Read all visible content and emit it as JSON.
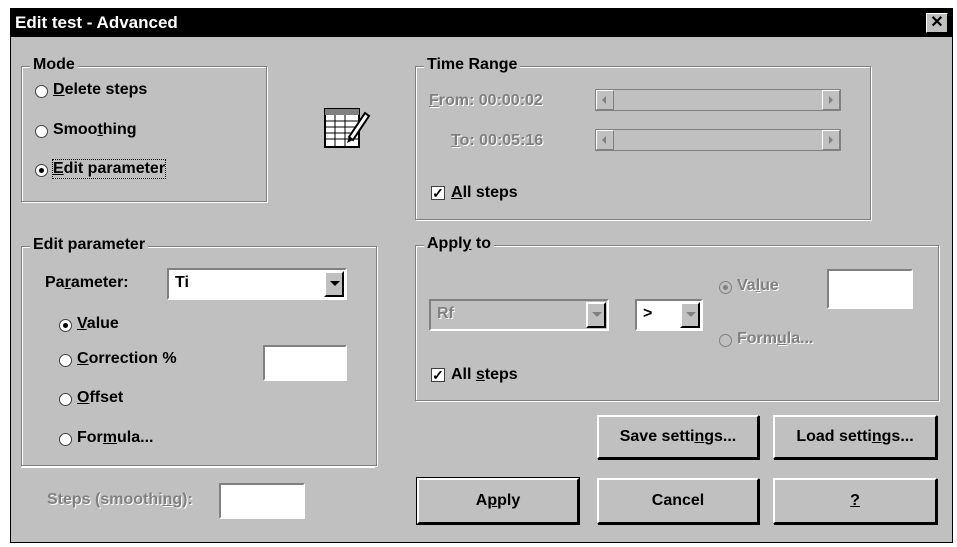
{
  "window": {
    "title": "Edit test - Advanced",
    "close_label": "✕"
  },
  "mode": {
    "legend": "Mode",
    "options": [
      {
        "label": "Delete steps",
        "selected": false
      },
      {
        "label": "Smoothing",
        "selected": false
      },
      {
        "label": "Edit parameter",
        "selected": true
      }
    ]
  },
  "edit_icon": "spreadsheet-edit-icon",
  "edit_parameter": {
    "legend": "Edit parameter",
    "parameter_label": "Parameter:",
    "parameter_value": "Ti",
    "options": [
      {
        "label": "Value",
        "selected": true
      },
      {
        "label": "Correction %",
        "selected": false
      },
      {
        "label": "Offset",
        "selected": false
      },
      {
        "label": "Formula...",
        "selected": false
      }
    ],
    "correction_value": ""
  },
  "steps_smoothing": {
    "label": "Steps (smoothing):",
    "value": ""
  },
  "time_range": {
    "legend": "Time Range",
    "from_label": "From:",
    "from_value": "00:00:02",
    "to_label": "To:",
    "to_value": "00:05:16",
    "all_steps_label": "All steps",
    "all_steps_checked": true
  },
  "apply_to": {
    "legend": "Apply to",
    "field_value": "Rf",
    "operator_value": ">",
    "value_option": "Value",
    "formula_option": "Formula...",
    "value_input": "",
    "all_steps_label": "All steps",
    "all_steps_checked": true
  },
  "buttons": {
    "save": "Save settings...",
    "load": "Load settings...",
    "apply": "Apply",
    "cancel": "Cancel",
    "help": "?"
  }
}
